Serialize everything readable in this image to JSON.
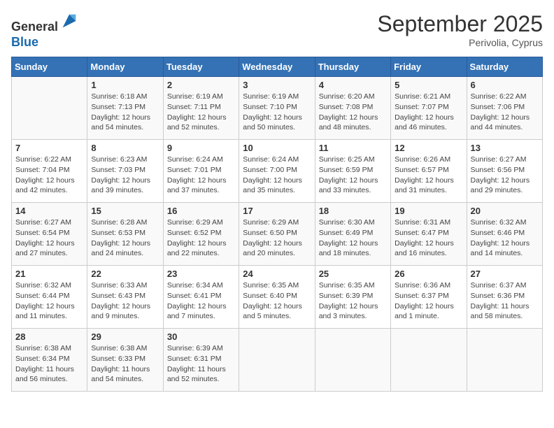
{
  "header": {
    "logo_line1": "General",
    "logo_line2": "Blue",
    "month_title": "September 2025",
    "subtitle": "Perivolia, Cyprus"
  },
  "days_of_week": [
    "Sunday",
    "Monday",
    "Tuesday",
    "Wednesday",
    "Thursday",
    "Friday",
    "Saturday"
  ],
  "weeks": [
    [
      {
        "day": "",
        "info": ""
      },
      {
        "day": "1",
        "info": "Sunrise: 6:18 AM\nSunset: 7:13 PM\nDaylight: 12 hours\nand 54 minutes."
      },
      {
        "day": "2",
        "info": "Sunrise: 6:19 AM\nSunset: 7:11 PM\nDaylight: 12 hours\nand 52 minutes."
      },
      {
        "day": "3",
        "info": "Sunrise: 6:19 AM\nSunset: 7:10 PM\nDaylight: 12 hours\nand 50 minutes."
      },
      {
        "day": "4",
        "info": "Sunrise: 6:20 AM\nSunset: 7:08 PM\nDaylight: 12 hours\nand 48 minutes."
      },
      {
        "day": "5",
        "info": "Sunrise: 6:21 AM\nSunset: 7:07 PM\nDaylight: 12 hours\nand 46 minutes."
      },
      {
        "day": "6",
        "info": "Sunrise: 6:22 AM\nSunset: 7:06 PM\nDaylight: 12 hours\nand 44 minutes."
      }
    ],
    [
      {
        "day": "7",
        "info": "Sunrise: 6:22 AM\nSunset: 7:04 PM\nDaylight: 12 hours\nand 42 minutes."
      },
      {
        "day": "8",
        "info": "Sunrise: 6:23 AM\nSunset: 7:03 PM\nDaylight: 12 hours\nand 39 minutes."
      },
      {
        "day": "9",
        "info": "Sunrise: 6:24 AM\nSunset: 7:01 PM\nDaylight: 12 hours\nand 37 minutes."
      },
      {
        "day": "10",
        "info": "Sunrise: 6:24 AM\nSunset: 7:00 PM\nDaylight: 12 hours\nand 35 minutes."
      },
      {
        "day": "11",
        "info": "Sunrise: 6:25 AM\nSunset: 6:59 PM\nDaylight: 12 hours\nand 33 minutes."
      },
      {
        "day": "12",
        "info": "Sunrise: 6:26 AM\nSunset: 6:57 PM\nDaylight: 12 hours\nand 31 minutes."
      },
      {
        "day": "13",
        "info": "Sunrise: 6:27 AM\nSunset: 6:56 PM\nDaylight: 12 hours\nand 29 minutes."
      }
    ],
    [
      {
        "day": "14",
        "info": "Sunrise: 6:27 AM\nSunset: 6:54 PM\nDaylight: 12 hours\nand 27 minutes."
      },
      {
        "day": "15",
        "info": "Sunrise: 6:28 AM\nSunset: 6:53 PM\nDaylight: 12 hours\nand 24 minutes."
      },
      {
        "day": "16",
        "info": "Sunrise: 6:29 AM\nSunset: 6:52 PM\nDaylight: 12 hours\nand 22 minutes."
      },
      {
        "day": "17",
        "info": "Sunrise: 6:29 AM\nSunset: 6:50 PM\nDaylight: 12 hours\nand 20 minutes."
      },
      {
        "day": "18",
        "info": "Sunrise: 6:30 AM\nSunset: 6:49 PM\nDaylight: 12 hours\nand 18 minutes."
      },
      {
        "day": "19",
        "info": "Sunrise: 6:31 AM\nSunset: 6:47 PM\nDaylight: 12 hours\nand 16 minutes."
      },
      {
        "day": "20",
        "info": "Sunrise: 6:32 AM\nSunset: 6:46 PM\nDaylight: 12 hours\nand 14 minutes."
      }
    ],
    [
      {
        "day": "21",
        "info": "Sunrise: 6:32 AM\nSunset: 6:44 PM\nDaylight: 12 hours\nand 11 minutes."
      },
      {
        "day": "22",
        "info": "Sunrise: 6:33 AM\nSunset: 6:43 PM\nDaylight: 12 hours\nand 9 minutes."
      },
      {
        "day": "23",
        "info": "Sunrise: 6:34 AM\nSunset: 6:41 PM\nDaylight: 12 hours\nand 7 minutes."
      },
      {
        "day": "24",
        "info": "Sunrise: 6:35 AM\nSunset: 6:40 PM\nDaylight: 12 hours\nand 5 minutes."
      },
      {
        "day": "25",
        "info": "Sunrise: 6:35 AM\nSunset: 6:39 PM\nDaylight: 12 hours\nand 3 minutes."
      },
      {
        "day": "26",
        "info": "Sunrise: 6:36 AM\nSunset: 6:37 PM\nDaylight: 12 hours\nand 1 minute."
      },
      {
        "day": "27",
        "info": "Sunrise: 6:37 AM\nSunset: 6:36 PM\nDaylight: 11 hours\nand 58 minutes."
      }
    ],
    [
      {
        "day": "28",
        "info": "Sunrise: 6:38 AM\nSunset: 6:34 PM\nDaylight: 11 hours\nand 56 minutes."
      },
      {
        "day": "29",
        "info": "Sunrise: 6:38 AM\nSunset: 6:33 PM\nDaylight: 11 hours\nand 54 minutes."
      },
      {
        "day": "30",
        "info": "Sunrise: 6:39 AM\nSunset: 6:31 PM\nDaylight: 11 hours\nand 52 minutes."
      },
      {
        "day": "",
        "info": ""
      },
      {
        "day": "",
        "info": ""
      },
      {
        "day": "",
        "info": ""
      },
      {
        "day": "",
        "info": ""
      }
    ]
  ]
}
